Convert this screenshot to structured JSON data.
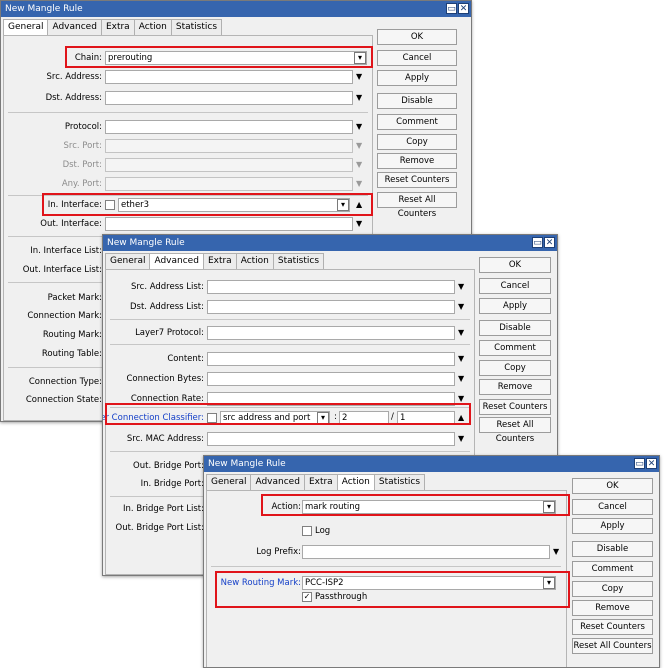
{
  "buttons": {
    "ok": "OK",
    "cancel": "Cancel",
    "apply": "Apply",
    "disable": "Disable",
    "comment": "Comment",
    "copy": "Copy",
    "remove": "Remove",
    "reset_counters": "Reset Counters",
    "reset_all_counters": "Reset All Counters"
  },
  "window_general": {
    "title": "New Mangle Rule",
    "tabs": [
      "General",
      "Advanced",
      "Extra",
      "Action",
      "Statistics"
    ],
    "active_tab": "General",
    "chain_label": "Chain:",
    "chain_value": "prerouting",
    "src_address_label": "Src. Address:",
    "dst_address_label": "Dst. Address:",
    "protocol_label": "Protocol:",
    "src_port_label": "Src. Port:",
    "dst_port_label": "Dst. Port:",
    "any_port_label": "Any. Port:",
    "in_interface_label": "In. Interface:",
    "in_interface_value": "ether3",
    "out_interface_label": "Out. Interface:",
    "in_interface_list_label": "In. Interface List:",
    "out_interface_list_label": "Out. Interface List:",
    "packet_mark_label": "Packet Mark:",
    "connection_mark_label": "Connection Mark:",
    "routing_mark_label": "Routing Mark:",
    "routing_table_label": "Routing Table:",
    "connection_type_label": "Connection Type:",
    "connection_state_label": "Connection State:"
  },
  "window_advanced": {
    "title": "New Mangle Rule",
    "tabs": [
      "General",
      "Advanced",
      "Extra",
      "Action",
      "Statistics"
    ],
    "active_tab": "Advanced",
    "src_address_list_label": "Src. Address List:",
    "dst_address_list_label": "Dst. Address List:",
    "layer7_protocol_label": "Layer7 Protocol:",
    "content_label": "Content:",
    "connection_bytes_label": "Connection Bytes:",
    "connection_rate_label": "Connection Rate:",
    "pcc_label": "Per Connection Classifier:",
    "pcc_type": "src address and port",
    "pcc_colon": ":",
    "pcc_denominator": "2",
    "pcc_slash": "/",
    "pcc_remainder": "1",
    "src_mac_address_label": "Src. MAC Address:",
    "out_bridge_port_label": "Out. Bridge Port:",
    "in_bridge_port_label": "In. Bridge Port:",
    "in_bridge_port_list_label": "In. Bridge Port List:",
    "out_bridge_port_list_label": "Out. Bridge Port List:"
  },
  "window_action": {
    "title": "New Mangle Rule",
    "tabs": [
      "General",
      "Advanced",
      "Extra",
      "Action",
      "Statistics"
    ],
    "active_tab": "Action",
    "action_label": "Action:",
    "action_value": "mark routing",
    "log_label": "Log",
    "log_checked": false,
    "log_prefix_label": "Log Prefix:",
    "new_routing_mark_label": "New Routing Mark:",
    "new_routing_mark_value": "PCC-ISP2",
    "passthrough_label": "Passthrough",
    "passthrough_checked": true
  },
  "colors": {
    "titlebar": "#3665ae",
    "highlight": "#e0141a",
    "link_label": "#1540c8"
  }
}
